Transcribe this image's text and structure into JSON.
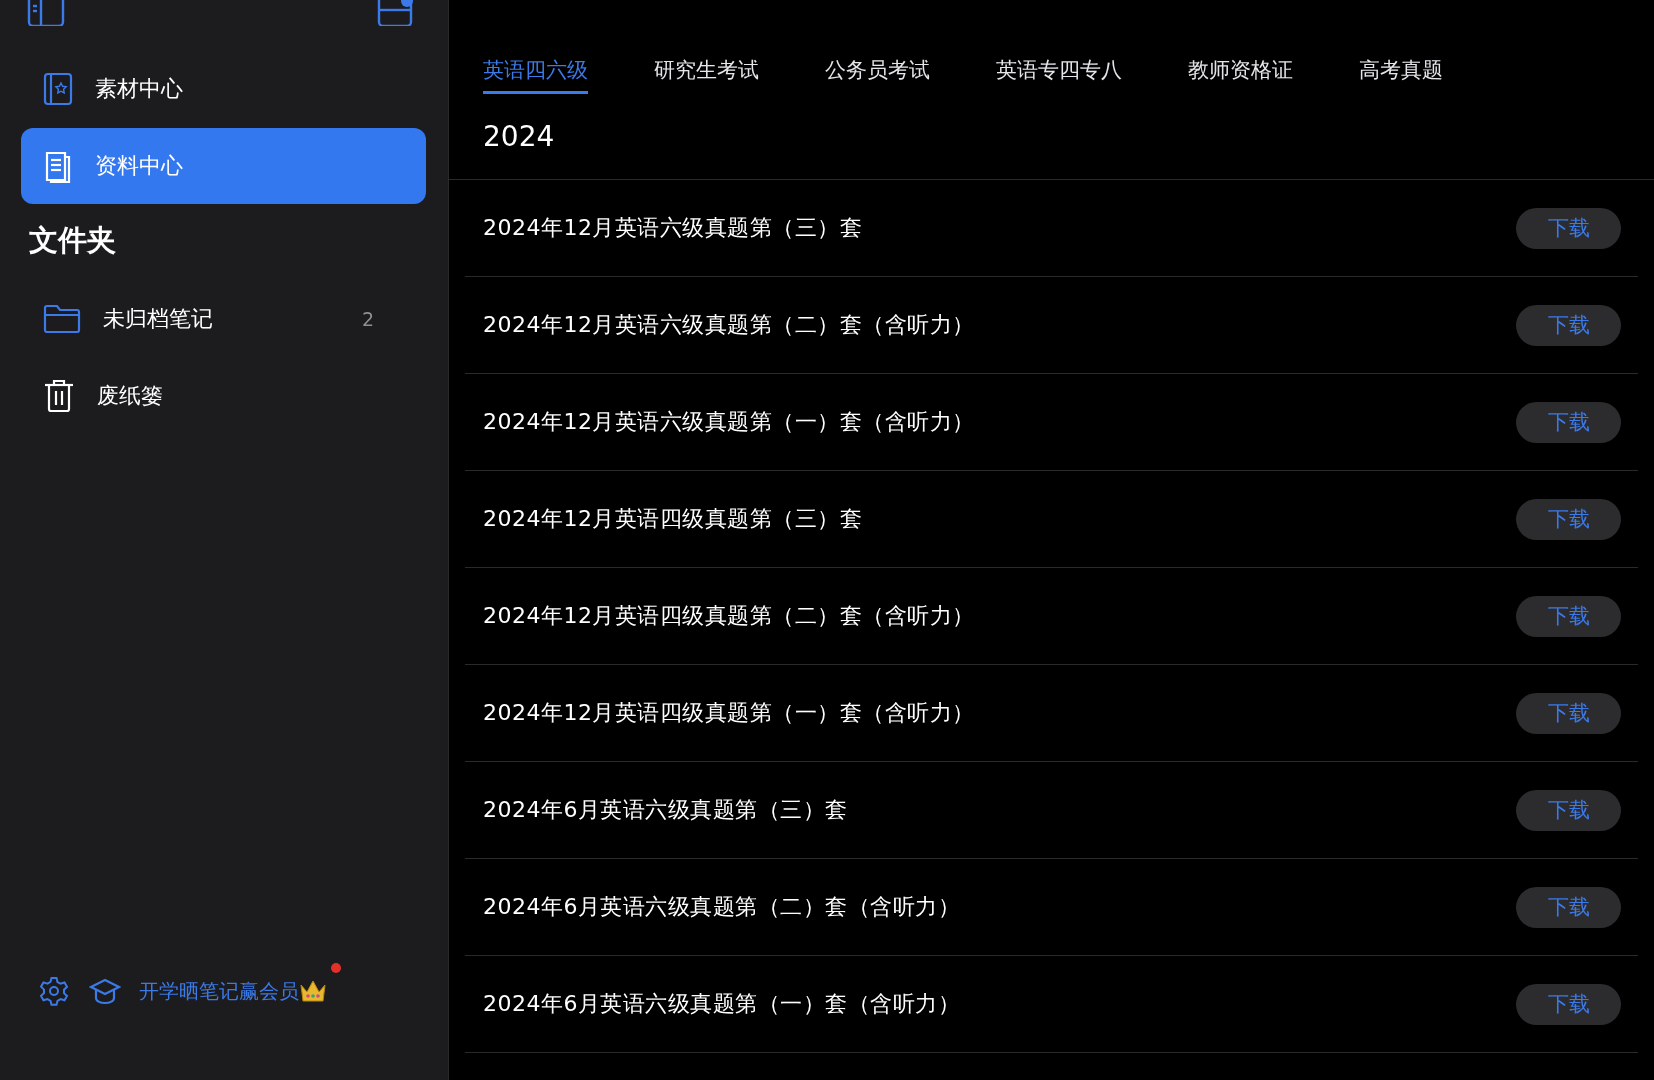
{
  "sidebar": {
    "nav": [
      {
        "label": "素材中心",
        "kind": "material",
        "selected": false
      },
      {
        "label": "资料中心",
        "kind": "docs",
        "selected": true
      }
    ],
    "folders_title": "文件夹",
    "folders": [
      {
        "label": "未归档笔记",
        "kind": "folder",
        "count": "2"
      },
      {
        "label": "废纸篓",
        "kind": "trash"
      }
    ],
    "promo": {
      "text": "开学晒笔记赢会员",
      "notification": true
    }
  },
  "tabs": [
    {
      "label": "英语四六级",
      "selected": true
    },
    {
      "label": "研究生考试",
      "selected": false
    },
    {
      "label": "公务员考试",
      "selected": false
    },
    {
      "label": "英语专四专八",
      "selected": false
    },
    {
      "label": "教师资格证",
      "selected": false
    },
    {
      "label": "高考真题",
      "selected": false
    }
  ],
  "section_title": "2024",
  "rows": [
    {
      "title": "2024年12月英语六级真题第（三）套",
      "button": "下载"
    },
    {
      "title": "2024年12月英语六级真题第（二）套（含听力）",
      "button": "下载"
    },
    {
      "title": "2024年12月英语六级真题第（一）套（含听力）",
      "button": "下载"
    },
    {
      "title": "2024年12月英语四级真题第（三）套",
      "button": "下载"
    },
    {
      "title": "2024年12月英语四级真题第（二）套（含听力）",
      "button": "下载"
    },
    {
      "title": "2024年12月英语四级真题第（一）套（含听力）",
      "button": "下载"
    },
    {
      "title": "2024年6月英语六级真题第（三）套",
      "button": "下载"
    },
    {
      "title": "2024年6月英语六级真题第（二）套（含听力）",
      "button": "下载"
    },
    {
      "title": "2024年6月英语六级真题第（一）套（含听力）",
      "button": "下载"
    }
  ]
}
